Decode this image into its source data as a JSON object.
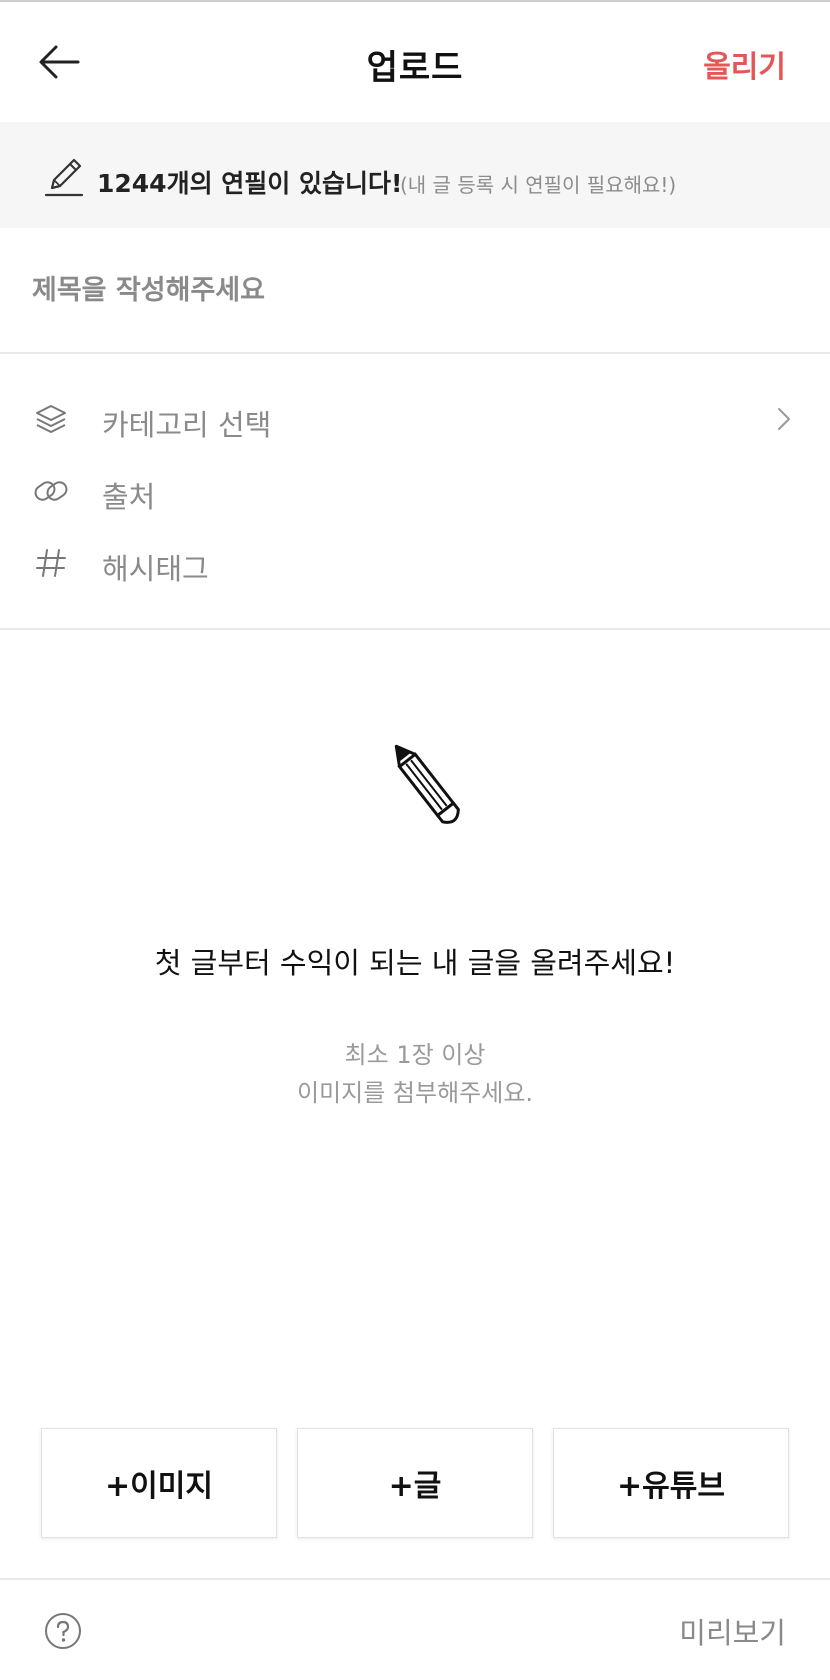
{
  "header": {
    "title": "업로드",
    "upload_label": "올리기",
    "accent_color": "#e35757"
  },
  "banner": {
    "count_text": "1244개의 연필이 있습니다!",
    "note_text": "(내 글 등록 시 연필이 필요해요!)",
    "icon": "pencil-icon"
  },
  "title_field": {
    "placeholder": "제목을 작성해주세요",
    "value": ""
  },
  "meta": {
    "items": [
      {
        "icon": "layers-icon",
        "label": "카테고리 선택",
        "has_chevron": true
      },
      {
        "icon": "link-icon",
        "label": "출처",
        "has_chevron": false
      },
      {
        "icon": "hashtag-icon",
        "label": "해시태그",
        "has_chevron": false
      }
    ]
  },
  "empty_state": {
    "icon": "pencil-icon",
    "message": "첫 글부터 수익이 되는 내 글을 올려주세요!",
    "sub_line1": "최소 1장 이상",
    "sub_line2": "이미지를 첨부해주세요."
  },
  "actions": {
    "add_image": "+이미지",
    "add_text": "+글",
    "add_youtube": "+유튜브"
  },
  "footer": {
    "help_icon": "help-circle-icon",
    "preview_label": "미리보기"
  }
}
